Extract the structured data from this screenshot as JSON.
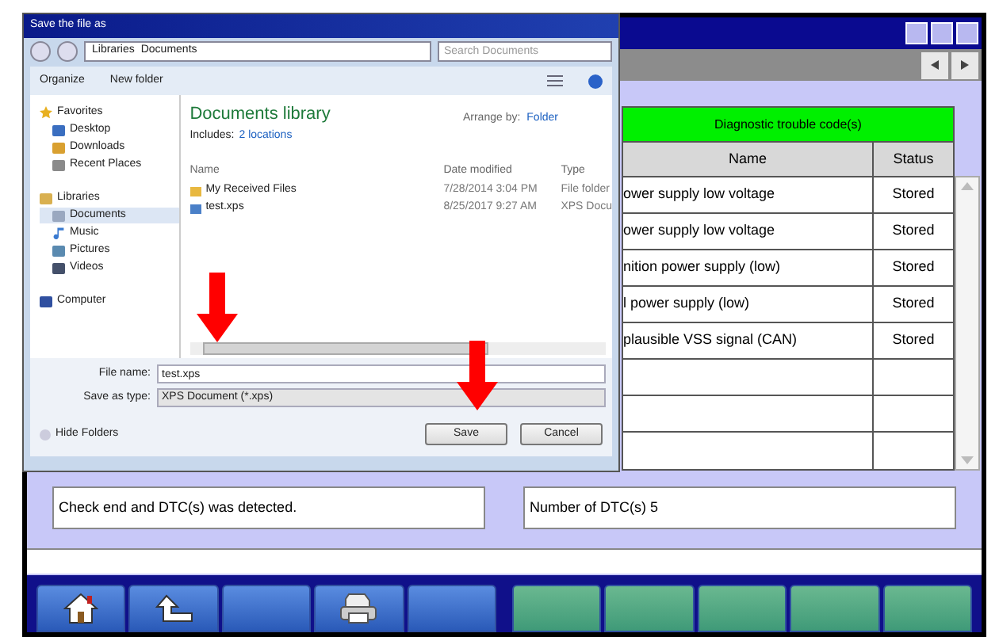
{
  "dialog": {
    "title": "Save the file as",
    "breadcrumb": [
      "Libraries",
      "Documents"
    ],
    "search": {
      "placeholder": "Search Documents"
    },
    "toolbar": [
      "Organize",
      "New folder"
    ],
    "nav": [
      {
        "label": "Favorites",
        "kind": "star",
        "selected": false,
        "children": [
          {
            "label": "Desktop",
            "kind": "desktop",
            "selected": false
          },
          {
            "label": "Downloads",
            "kind": "download",
            "selected": false
          },
          {
            "label": "Recent Places",
            "kind": "recent",
            "selected": false
          }
        ]
      },
      {
        "label": "Libraries",
        "kind": "library",
        "selected": false,
        "children": [
          {
            "label": "Documents",
            "kind": "document",
            "selected": true
          },
          {
            "label": "Music",
            "kind": "music",
            "selected": false
          },
          {
            "label": "Pictures",
            "kind": "picture",
            "selected": false
          },
          {
            "label": "Videos",
            "kind": "video",
            "selected": false
          }
        ]
      },
      {
        "label": "Computer",
        "kind": "computer",
        "selected": false
      }
    ],
    "library_title": "Documents library",
    "includes_label": "Includes:",
    "includes_link": "2 locations",
    "arrange_label": "Arrange by:",
    "arrange_value": "Folder",
    "columns": [
      "Name",
      "Date modified",
      "Type"
    ],
    "files": [
      {
        "name": "My Received Files",
        "date": "7/28/2014 3:04 PM",
        "type": "File folder",
        "kind": "folder"
      },
      {
        "name": "test.xps",
        "date": "8/25/2017 9:27 AM",
        "type": "XPS Docu",
        "kind": "xps"
      }
    ],
    "file_name": {
      "label": "File name:",
      "value": "test.xps"
    },
    "save_type": {
      "label": "Save as type:",
      "value": "XPS Document (*.xps)"
    },
    "hide_folders": "Hide Folders",
    "buttons": [
      "Save",
      "Cancel"
    ]
  },
  "table": {
    "title": "Diagnostic trouble code(s)",
    "columns": [
      "Name",
      "Status"
    ],
    "rows": [
      {
        "name": "ower supply low voltage",
        "status": "Stored"
      },
      {
        "name": "ower supply low voltage",
        "status": "Stored"
      },
      {
        "name": "nition power supply (low)",
        "status": "Stored"
      },
      {
        "name": "l power supply (low)",
        "status": "Stored"
      },
      {
        "name": "plausible VSS signal (CAN)",
        "status": "Stored"
      }
    ]
  },
  "messages": [
    "Check end and DTC(s) was detected.",
    "Number of DTC(s) 5"
  ],
  "bottom_buttons": [
    {
      "kind": "home"
    },
    {
      "kind": "back"
    },
    {
      "kind": "blank"
    },
    {
      "kind": "print"
    },
    {
      "kind": "blank"
    },
    {
      "kind": "green"
    },
    {
      "kind": "green"
    },
    {
      "kind": "green"
    },
    {
      "kind": "green"
    },
    {
      "kind": "green"
    }
  ]
}
